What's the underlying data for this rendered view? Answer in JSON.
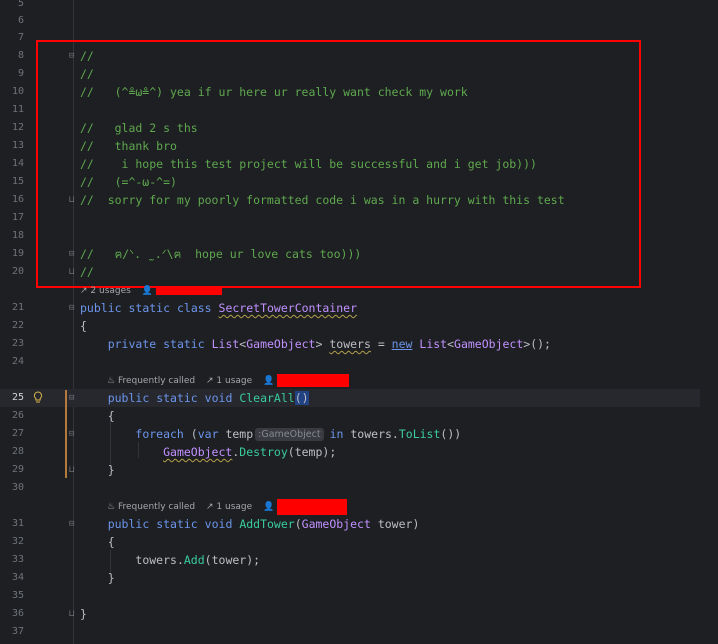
{
  "gutter": {
    "lines": [
      "5",
      "6",
      "7",
      "8",
      "9",
      "10",
      "11",
      "12",
      "13",
      "14",
      "15",
      "16",
      "17",
      "18",
      "19",
      "20",
      "21",
      "22",
      "23",
      "24",
      "25",
      "26",
      "27",
      "28",
      "29",
      "30",
      "31",
      "32",
      "33",
      "34",
      "35",
      "36",
      "37"
    ],
    "current_line": "25"
  },
  "comments": {
    "l8": "//",
    "l9": "//",
    "l10": "//   (^≗ω≗^) yea if ur here ur really want check my work",
    "l12": "//   glad 2 s ths",
    "l13": "//   thank bro",
    "l14": "//    i hope this test project will be successful and i get job)))",
    "l15": "//   (=^-ω-^=)",
    "l16": "//  sorry for my poorly formatted code i was in a hurry with this test",
    "l19": "//   ฅ/ᐠ. ̫ .ᐟ\\ฅ  hope ur love cats too)))",
    "l20": "//"
  },
  "hints": {
    "class_usages": "2 usages",
    "frequently_called": "Frequently called",
    "one_usage": "1 usage"
  },
  "code": {
    "public": "public",
    "static": "static",
    "class": "class",
    "class_name": "SecretTowerContainer",
    "private": "private",
    "list": "List",
    "gameobject": "GameObject",
    "towers": "towers",
    "new": "new",
    "void": "void",
    "clearall": "ClearAll",
    "foreach": "foreach",
    "var": "var",
    "temp": "temp",
    "temp_type_hint": ":GameObject",
    "in": "in",
    "tolist": "ToList",
    "destroy": "Destroy",
    "addtower": "AddTower",
    "tower": "tower",
    "add": "Add"
  },
  "colors": {
    "background": "#1e1f22",
    "comment": "#5fa84f",
    "keyword": "#6c95eb",
    "type": "#c191ff",
    "method": "#39cc9b",
    "annotation_box": "#ff0000"
  }
}
